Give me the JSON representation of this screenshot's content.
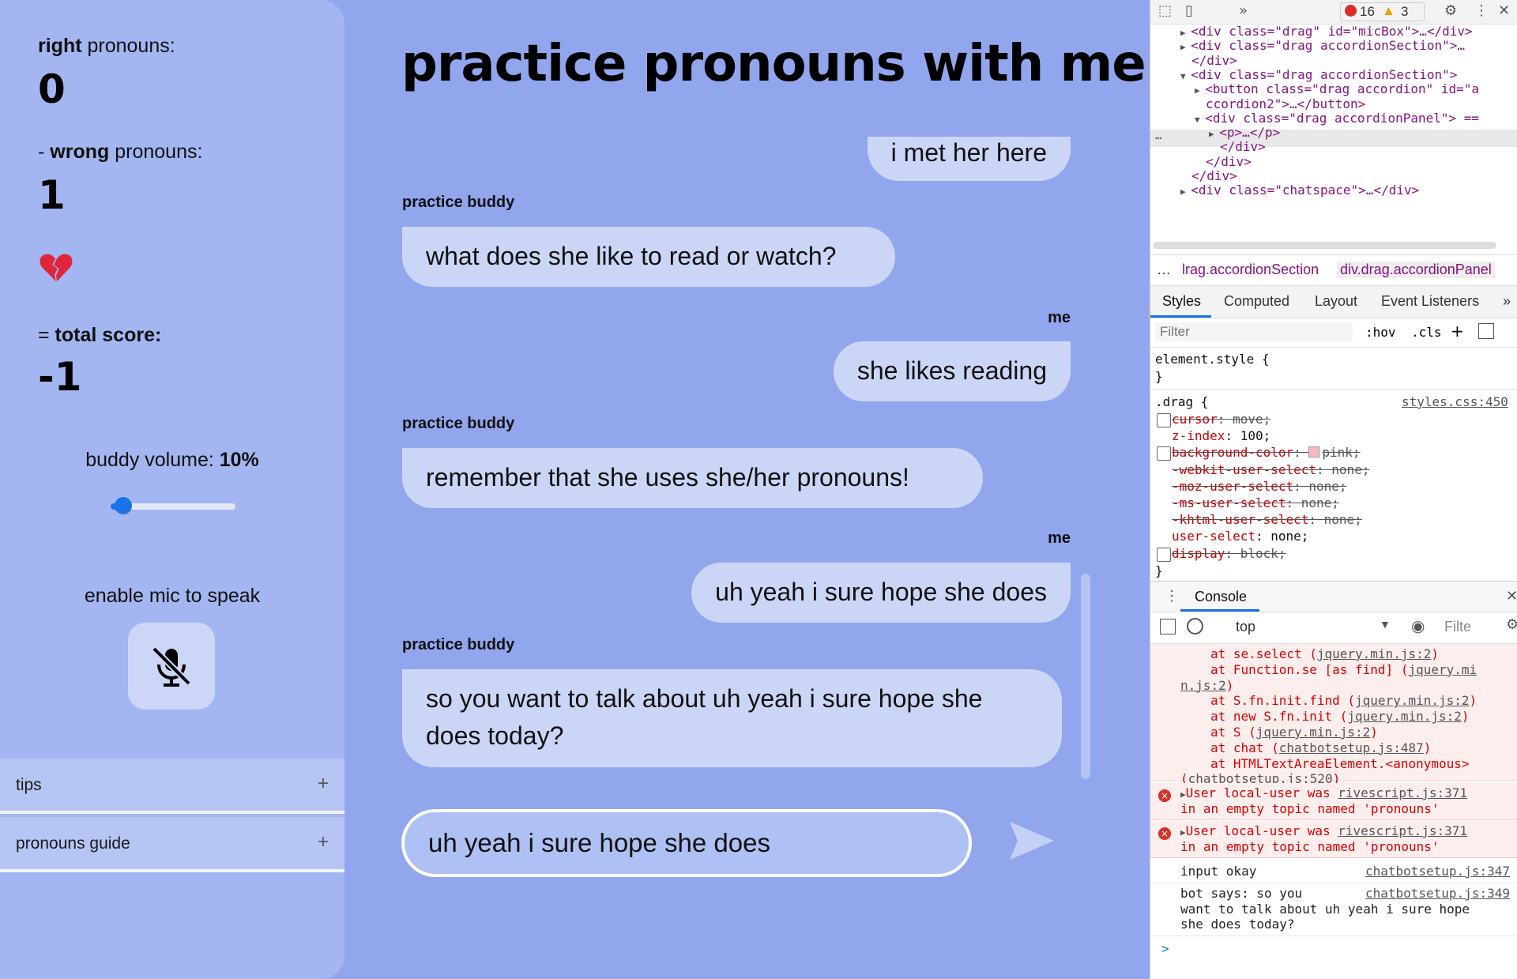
{
  "app": {
    "title": "practice pronouns with me!",
    "scores": {
      "right_strong": "right",
      "right_rest": " pronouns:",
      "right_value": "0",
      "wrong_prefix": "- ",
      "wrong_strong": "wrong",
      "wrong_rest": " pronouns:",
      "wrong_value": "1",
      "total_prefix": "= ",
      "total_strong": "total score:",
      "total_value": "-1"
    },
    "volume": {
      "label": "buddy volume: ",
      "value_label": "10%",
      "value": 0.1
    },
    "mic": {
      "label": "enable mic to speak",
      "icon": "mic-off-icon"
    },
    "accordions": [
      {
        "label": "tips",
        "icon": "+"
      },
      {
        "label": "pronouns guide",
        "icon": "+"
      }
    ],
    "chat": {
      "messages": [
        {
          "sender": "me",
          "text": "i met her here"
        },
        {
          "sender": "practice buddy",
          "text": "what does she like to read or watch?"
        },
        {
          "sender": "me",
          "text": "she likes reading"
        },
        {
          "sender": "practice buddy",
          "text": "remember that she uses she/her pronouns!"
        },
        {
          "sender": "me",
          "text": "uh yeah i sure hope she does"
        },
        {
          "sender": "practice buddy",
          "text": "so you want to talk about uh yeah i sure hope she does today?"
        }
      ],
      "sender_labels": {
        "me": "me",
        "bot": "practice buddy"
      },
      "input_value": "uh yeah i sure hope she does"
    },
    "colors": {
      "background": "#92a6ee",
      "sidebar": "#a3b6f1",
      "bubble": "#cbd6f7",
      "accent": "#1a73e8"
    }
  },
  "devtools": {
    "error_count": "16",
    "warning_count": "3",
    "elements": [
      {
        "indent": 0,
        "arrow": "▶",
        "html": "<div class=\"drag\" id=\"micBox\">…</div>"
      },
      {
        "indent": 0,
        "arrow": "▶",
        "html": "<div class=\"drag accordionSection\">…"
      },
      {
        "indent": 0,
        "arrow": "",
        "html": "</div>"
      },
      {
        "indent": 0,
        "arrow": "▼",
        "html": "<div class=\"drag accordionSection\">"
      },
      {
        "indent": 1,
        "arrow": "▶",
        "html": "<button class=\"drag accordion\" id=\"a"
      },
      {
        "indent": 1,
        "arrow": "",
        "html": "ccordion2\">…</button>"
      },
      {
        "indent": 1,
        "arrow": "▼",
        "html": "<div class=\"drag accordionPanel\"> =="
      },
      {
        "indent": 2,
        "arrow": "▶",
        "html": "<p>…</p>"
      },
      {
        "indent": 2,
        "arrow": "",
        "html": "</div>"
      },
      {
        "indent": 1,
        "arrow": "",
        "html": "</div>"
      },
      {
        "indent": 0,
        "arrow": "",
        "html": "</div>"
      },
      {
        "indent": 0,
        "arrow": "▶",
        "html": "<div class=\"chatspace\">…</div>"
      }
    ],
    "breadcrumbs": [
      "…",
      "lrag.accordionSection",
      "div.drag.accordionPanel"
    ],
    "style_tabs": [
      "Styles",
      "Computed",
      "Layout",
      "Event Listeners",
      "»"
    ],
    "filter_placeholder": "Filter",
    "filter_buttons": [
      ":hov",
      ".cls",
      "+"
    ],
    "element_style": "element.style {",
    "close_brace": "}",
    "rule_selector": ".drag {",
    "rule_source": "styles.css:450",
    "rules": [
      {
        "prop": "cursor",
        "value": "move;",
        "struck": true,
        "checkbox": true
      },
      {
        "prop": "z-index",
        "value": "100;",
        "struck": false,
        "checkbox": false
      },
      {
        "prop": "background-color",
        "value": "pink;",
        "struck": true,
        "checkbox": true
      },
      {
        "prop": "-webkit-user-select",
        "value": "none;",
        "struck": true,
        "checkbox": false
      },
      {
        "prop": "-moz-user-select",
        "value": "none;",
        "struck": true,
        "checkbox": false
      },
      {
        "prop": "-ms-user-select",
        "value": "none;",
        "struck": true,
        "checkbox": false
      },
      {
        "prop": "-khtml-user-select",
        "value": "none;",
        "struck": true,
        "checkbox": false
      },
      {
        "prop": "user-select",
        "value": "none;",
        "struck": false,
        "checkbox": false
      },
      {
        "prop": "display",
        "value": "block;",
        "struck": true,
        "checkbox": true
      }
    ],
    "console_title": "Console",
    "console_context": "top",
    "console_filter": "Filte",
    "stack": [
      {
        "text": "at se.select (",
        "link": "jquery.min.js:2",
        "end": ")"
      },
      {
        "text": "at Function.se [as find] (",
        "link": "jquery.mi",
        "end": ""
      },
      {
        "text": "",
        "link": "n.js:2",
        "end": ")"
      },
      {
        "text": "at S.fn.init.find (",
        "link": "jquery.min.js:2",
        "end": ")"
      },
      {
        "text": "at new S.fn.init (",
        "link": "jquery.min.js:2",
        "end": ")"
      },
      {
        "text": "at S (",
        "link": "jquery.min.js:2",
        "end": ")"
      },
      {
        "text": "at chat (",
        "link": "chatbotsetup.js:487",
        "end": ")"
      },
      {
        "text": "at HTMLTextAreaElement.<anonymous>",
        "link": "",
        "end": ""
      },
      {
        "text": "(",
        "link": "chatbotsetup.js:520",
        "end": ")"
      }
    ],
    "errors": [
      {
        "line1": "User local-user was ",
        "link": "rivescript.js:371",
        "line2": "in an empty topic named 'pronouns'"
      },
      {
        "line1": "User local-user was ",
        "link": "rivescript.js:371",
        "line2": "in an empty topic named 'pronouns'"
      }
    ],
    "logs": [
      {
        "lines": [
          "input okay"
        ],
        "src": "chatbotsetup.js:347"
      },
      {
        "lines": [
          "bot says:  so you",
          "want to talk about uh yeah i sure hope",
          "she does today?"
        ],
        "src": "chatbotsetup.js:349"
      }
    ],
    "prompt": ">"
  }
}
